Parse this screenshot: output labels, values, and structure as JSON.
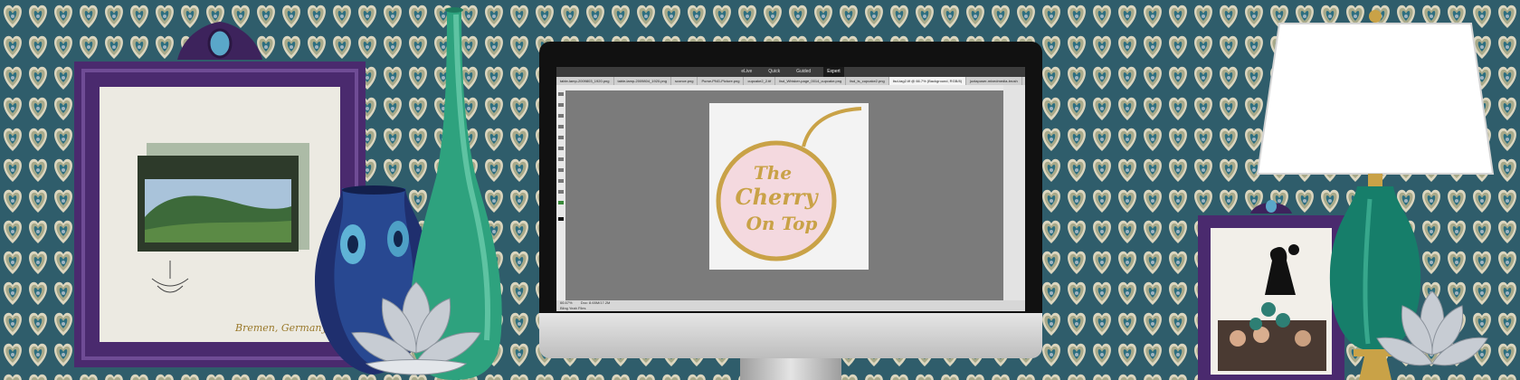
{
  "scene": {
    "colors": {
      "wall_teal": "#2f5d6b",
      "wall_olive": "#a7a98a",
      "wall_cream": "#dcd6bf",
      "frame_purple": "#4a2a6e",
      "vase_green": "#2ea27e",
      "lamp_base": "#167e6a",
      "gold": "#c9a247"
    },
    "objects": [
      "purple-picture-frame",
      "peacock-vase",
      "green-bottle-vase",
      "lotus-candle-holder",
      "desktop-monitor",
      "small-purple-photo-frame",
      "table-lamp"
    ]
  },
  "editor": {
    "modes": [
      "eLive",
      "Quick",
      "Guided",
      "Expert"
    ],
    "active_mode": "Expert",
    "tabs": [
      "table-lamp-2009803_1920.png",
      "table-lamp-2009804_1920.png",
      "sconce.png",
      "Purse-PNG-Picture.png",
      "cupcake2_2.tif",
      "lisd_Whisker-page_0014_cupcake.png",
      "lisd_ts_cupcake2.png",
      "lisd-tag2.tif @ 66.7% (Background, RGB/8)",
      "juxtaposer-mixedmedia-brush"
    ],
    "active_tab_index": 7,
    "status": {
      "zoom": "66.67%",
      "doc_info": "Doc: 8.65M/17.2M"
    },
    "footer_label": "Bling Yeah Files",
    "document": {
      "logo_lines": [
        "The",
        "Cherry",
        "On Top"
      ]
    }
  },
  "frame_art": {
    "caption": "Bremen, Germany"
  }
}
